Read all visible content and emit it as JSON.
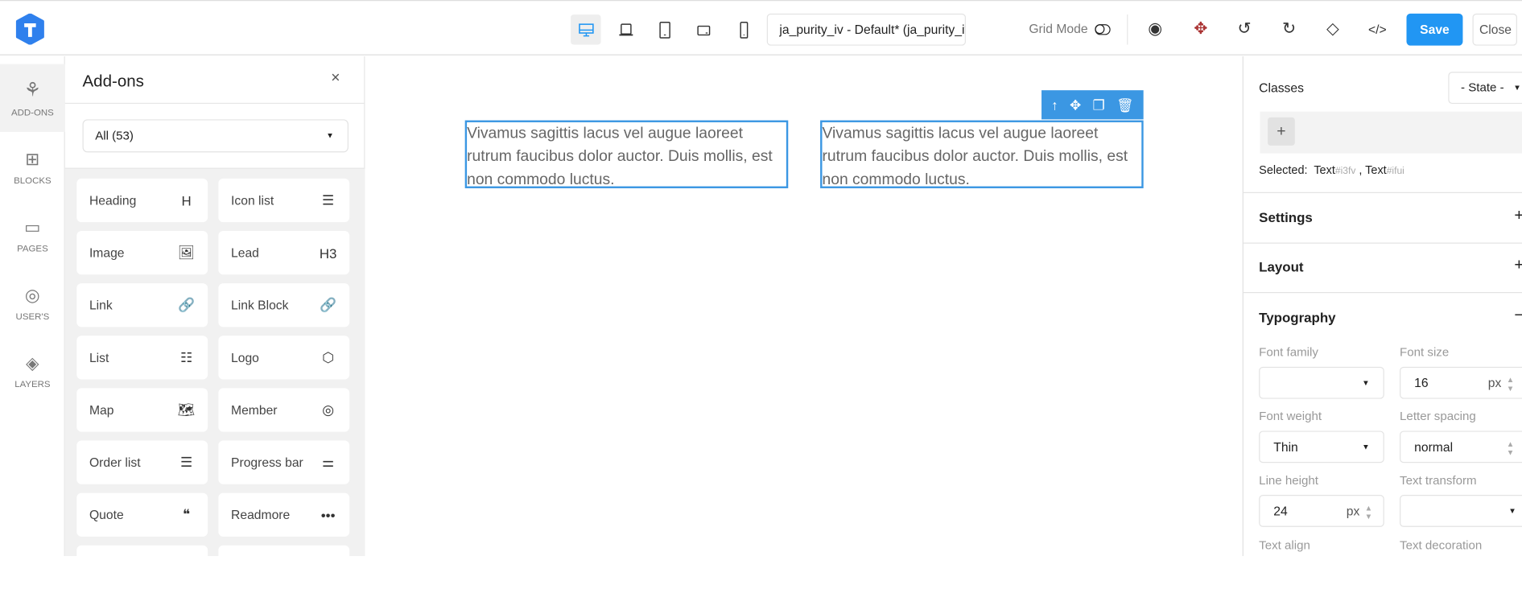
{
  "topbar": {
    "logo_letter": "T",
    "devices": [
      "desktop",
      "laptop",
      "tablet",
      "tablet-landscape",
      "mobile"
    ],
    "theme_select": "ja_purity_iv - Default* (ja_purity_iv)",
    "grid_mode_label": "Grid Mode",
    "save_label": "Save",
    "close_label": "Close",
    "accent": "#2196f3"
  },
  "rail": {
    "items": [
      {
        "label": "ADD-ONS"
      },
      {
        "label": "BLOCKS"
      },
      {
        "label": "PAGES"
      },
      {
        "label": "USER'S"
      },
      {
        "label": "LAYERS"
      }
    ]
  },
  "addons": {
    "title": "Add-ons",
    "close": "×",
    "filter": "All (53)",
    "items": [
      {
        "label": "Heading",
        "icon": "H"
      },
      {
        "label": "Icon list",
        "icon": "☰"
      },
      {
        "label": "Image",
        "icon": "🖼"
      },
      {
        "label": "Lead",
        "icon": "H3"
      },
      {
        "label": "Link",
        "icon": "🔗"
      },
      {
        "label": "Link Block",
        "icon": "🔗"
      },
      {
        "label": "List",
        "icon": "☷"
      },
      {
        "label": "Logo",
        "icon": "⬡"
      },
      {
        "label": "Map",
        "icon": "🗺"
      },
      {
        "label": "Member",
        "icon": "◎"
      },
      {
        "label": "Order list",
        "icon": "☰"
      },
      {
        "label": "Progress bar",
        "icon": "⚌"
      },
      {
        "label": "Quote",
        "icon": "❝"
      },
      {
        "label": "Readmore",
        "icon": "•••"
      }
    ]
  },
  "canvas": {
    "text_blocks": [
      {
        "lines": [
          "Vivamus sagittis lacus vel augue laoreet",
          "rutrum faucibus dolor auctor. Duis mollis, est",
          "non commodo luctus."
        ]
      },
      {
        "lines": [
          "Vivamus sagittis lacus vel augue laoreet",
          "rutrum faucibus dolor auctor. Duis mollis, est",
          "non commodo luctus."
        ]
      }
    ]
  },
  "style_panel": {
    "classes_label": "Classes",
    "state_select": "- State -",
    "selected_label": "Selected:",
    "selected": [
      {
        "name": "Text",
        "id": "#i3fv"
      },
      {
        "name": "Text",
        "id": "#ifui"
      }
    ],
    "sections": {
      "settings": "Settings",
      "layout": "Layout",
      "typography": "Typography"
    },
    "typography": {
      "font_family_label": "Font family",
      "font_family_value": "",
      "font_size_label": "Font size",
      "font_size_value": "16",
      "font_size_unit": "px",
      "font_weight_label": "Font weight",
      "font_weight_value": "Thin",
      "letter_spacing_label": "Letter spacing",
      "letter_spacing_value": "normal",
      "line_height_label": "Line height",
      "line_height_value": "24",
      "line_height_unit": "px",
      "text_transform_label": "Text transform",
      "text_transform_value": "",
      "text_align_label": "Text align",
      "text_decoration_label": "Text decoration"
    }
  }
}
